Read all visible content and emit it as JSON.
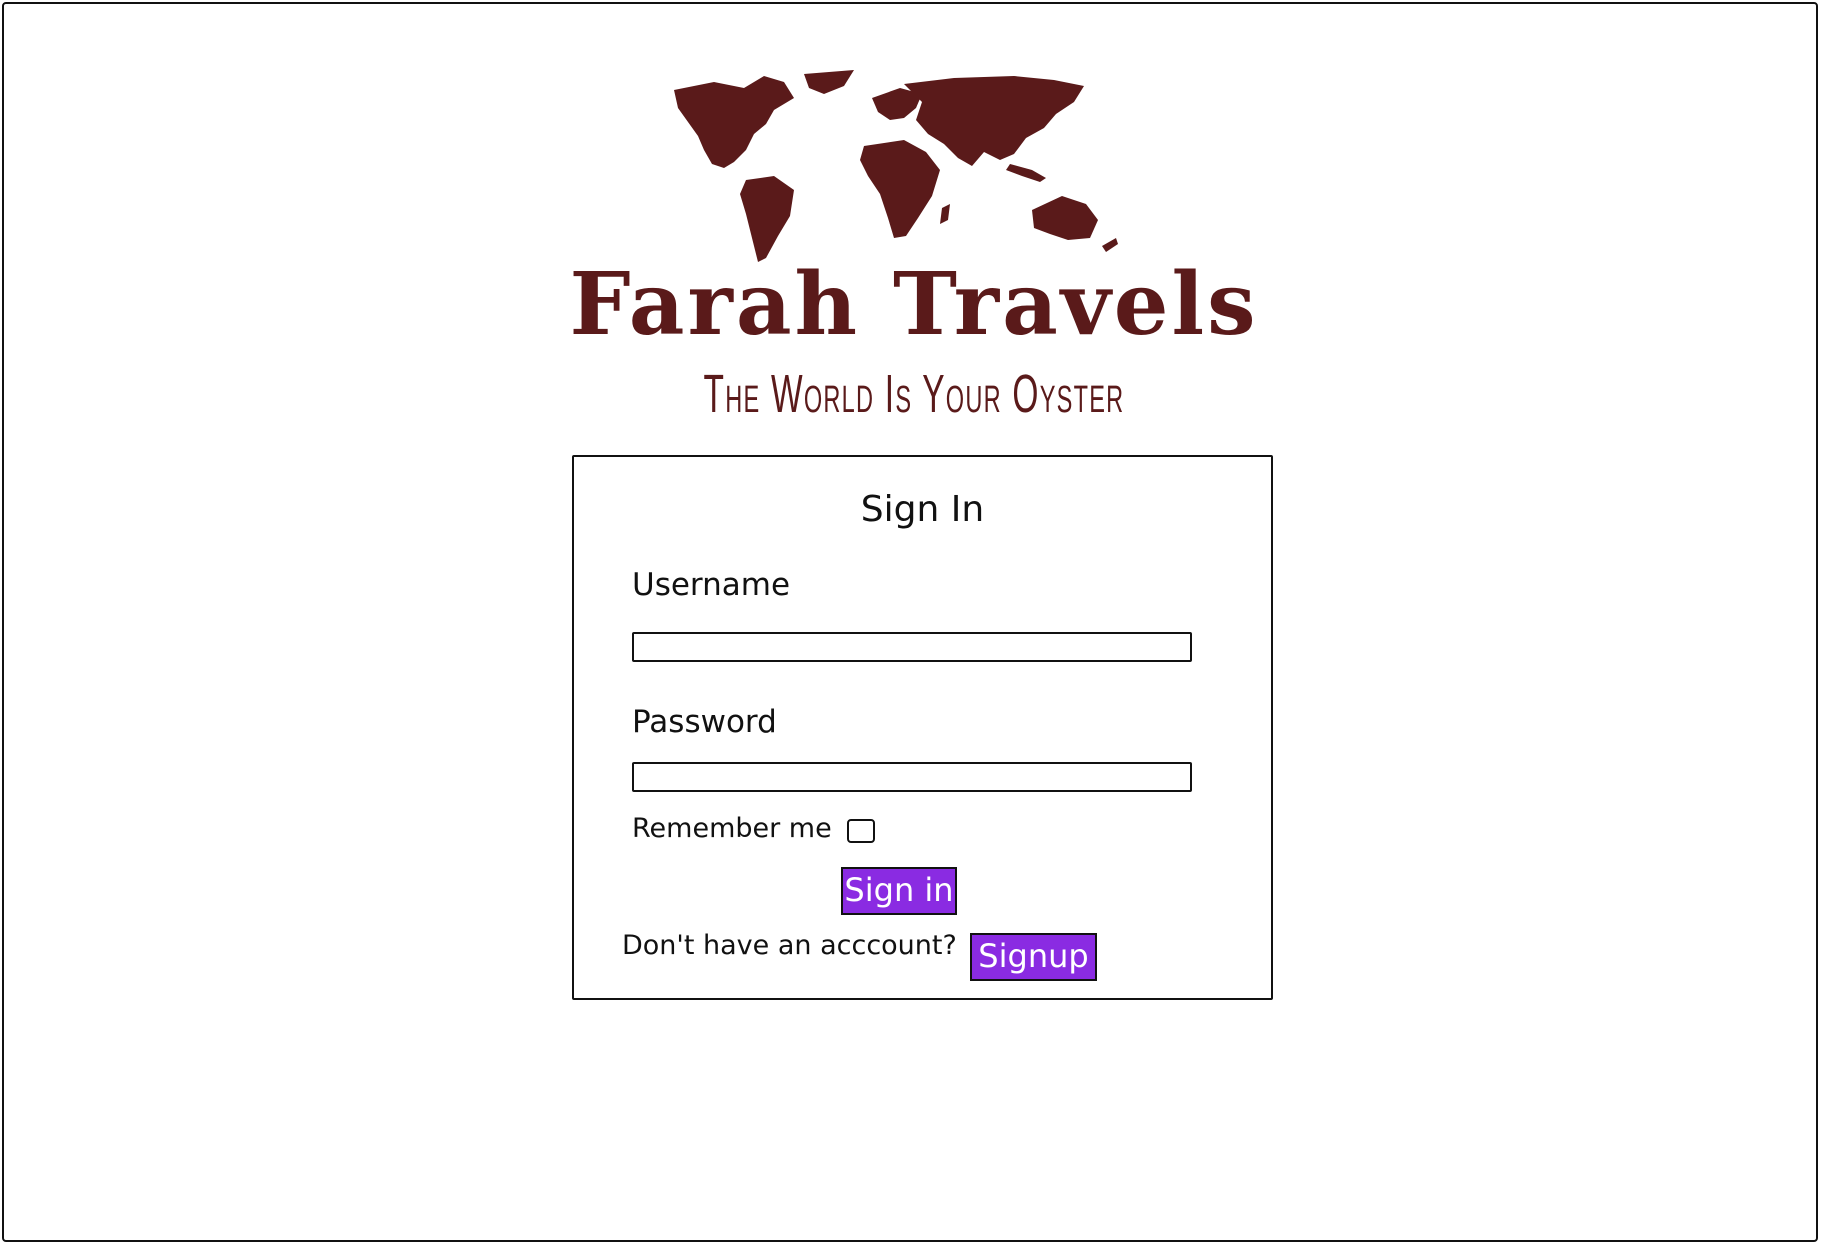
{
  "brand": {
    "name": "Farah Travels",
    "tagline": "The World Is Your Oyster",
    "logo_icon": "world-map-icon",
    "color": "#5a1a1a"
  },
  "signin": {
    "title": "Sign In",
    "username_label": "Username",
    "username_value": "",
    "password_label": "Password",
    "password_value": "",
    "remember_label": "Remember me",
    "remember_checked": false,
    "signin_button": "Sign in",
    "signup_prompt": "Don't have an acccount?",
    "signup_button": "Signup"
  },
  "colors": {
    "button_bg": "#8a2be2",
    "button_text": "#ffffff",
    "border": "#111111"
  }
}
